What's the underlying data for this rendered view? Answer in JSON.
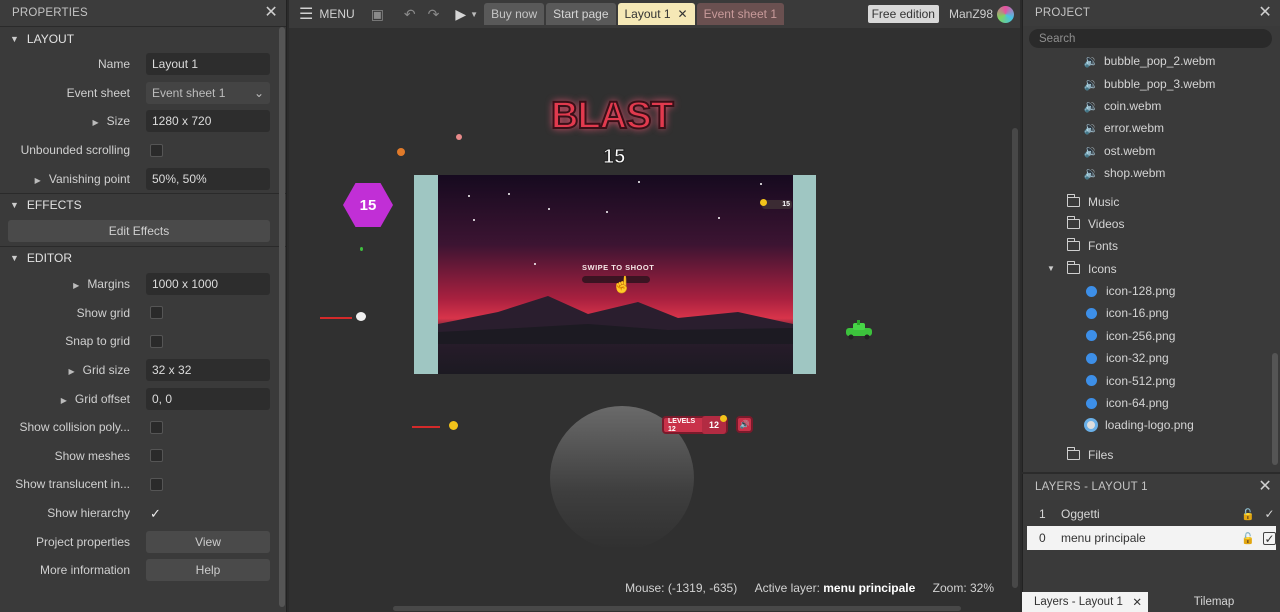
{
  "properties": {
    "title": "PROPERTIES",
    "layout_section": "LAYOUT",
    "name_label": "Name",
    "name_value": "Layout 1",
    "event_sheet_label": "Event sheet",
    "event_sheet_value": "Event sheet 1",
    "size_label": "Size",
    "size_value": "1280 x 720",
    "unbounded_label": "Unbounded scrolling",
    "vanishing_label": "Vanishing point",
    "vanishing_value": "50%, 50%",
    "effects_section": "EFFECTS",
    "edit_effects": "Edit Effects",
    "editor_section": "EDITOR",
    "margins_label": "Margins",
    "margins_value": "1000 x 1000",
    "show_grid_label": "Show grid",
    "snap_grid_label": "Snap to grid",
    "grid_size_label": "Grid size",
    "grid_size_value": "32 x 32",
    "grid_offset_label": "Grid offset",
    "grid_offset_value": "0, 0",
    "show_collision_label": "Show collision poly...",
    "show_meshes_label": "Show meshes",
    "show_translucent_label": "Show translucent in...",
    "show_hierarchy_label": "Show hierarchy",
    "project_props_label": "Project properties",
    "project_props_btn": "View",
    "more_info_label": "More information",
    "more_info_btn": "Help"
  },
  "toolbar": {
    "menu": "MENU",
    "tabs": [
      "Buy now",
      "Start page",
      "Layout 1",
      "Event sheet 1"
    ],
    "free_edition": "Free edition",
    "user": "ManZ98"
  },
  "canvas": {
    "game_title": "BLAST",
    "score": "15",
    "enemy_value": "15",
    "swipe_text": "SWIPE TO SHOOT",
    "hud_coins": "15",
    "levels_label": "LEVELS",
    "levels_value": "12",
    "levels_badge": "12"
  },
  "status": {
    "mouse": "Mouse: (-1319, -635)",
    "active_layer_label": "Active layer:",
    "active_layer_value": "menu principale",
    "zoom": "Zoom: 32%"
  },
  "project": {
    "title": "PROJECT",
    "search_placeholder": "Search",
    "sounds": [
      "bubble_pop_2.webm",
      "bubble_pop_3.webm",
      "coin.webm",
      "error.webm",
      "ost.webm",
      "shop.webm"
    ],
    "folders_a": [
      "Music",
      "Videos",
      "Fonts"
    ],
    "icons_folder": "Icons",
    "icons": [
      "icon-128.png",
      "icon-16.png",
      "icon-256.png",
      "icon-32.png",
      "icon-512.png",
      "icon-64.png"
    ],
    "loading_logo": "loading-logo.png",
    "files_folder": "Files"
  },
  "layers": {
    "title": "LAYERS - LAYOUT 1",
    "items": [
      {
        "num": "1",
        "name": "Oggetti"
      },
      {
        "num": "0",
        "name": "menu principale"
      }
    ]
  },
  "bottom_tabs": {
    "layers_tab": "Layers - Layout 1",
    "tilemap_tab": "Tilemap"
  },
  "colors": {
    "accent_tab": "#f5e8b6",
    "brand_red": "#e23a4e"
  }
}
